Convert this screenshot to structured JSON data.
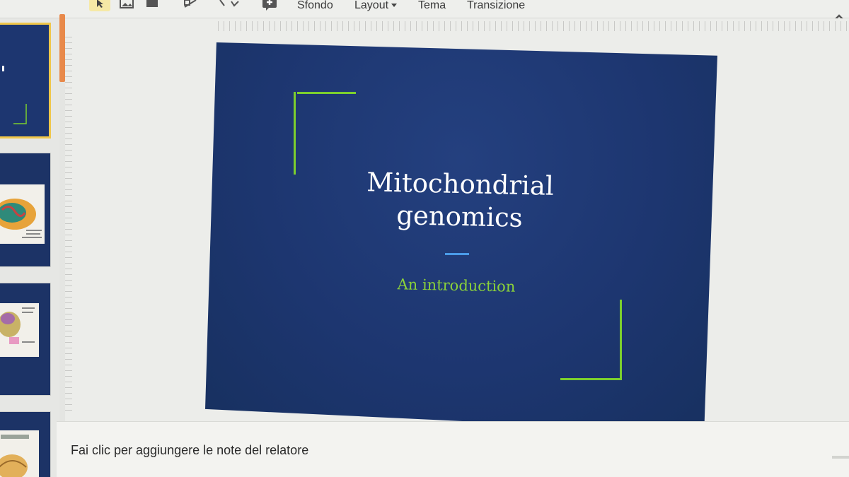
{
  "toolbar": {
    "icons": [
      "pointer-icon",
      "image-icon",
      "shape-icon",
      "line-icon",
      "add-comment-icon"
    ],
    "background_label": "Sfondo",
    "layout_label": "Layout",
    "theme_label": "Tema",
    "transition_label": "Transizione"
  },
  "filmstrip": {
    "thumbnails": [
      {
        "index": 1,
        "selected": true
      },
      {
        "index": 2,
        "selected": false
      },
      {
        "index": 3,
        "selected": false
      },
      {
        "index": 4,
        "selected": false
      }
    ]
  },
  "slide": {
    "title_line1": "Mitochondrial",
    "title_line2": "genomics",
    "subtitle": "An introduction",
    "colors": {
      "background": "#1d3670",
      "accent_green": "#7ccf2e",
      "accent_blue": "#4a9be8",
      "subtitle": "#8ad13a"
    }
  },
  "notes": {
    "placeholder": "Fai clic per aggiungere le note del relatore"
  }
}
